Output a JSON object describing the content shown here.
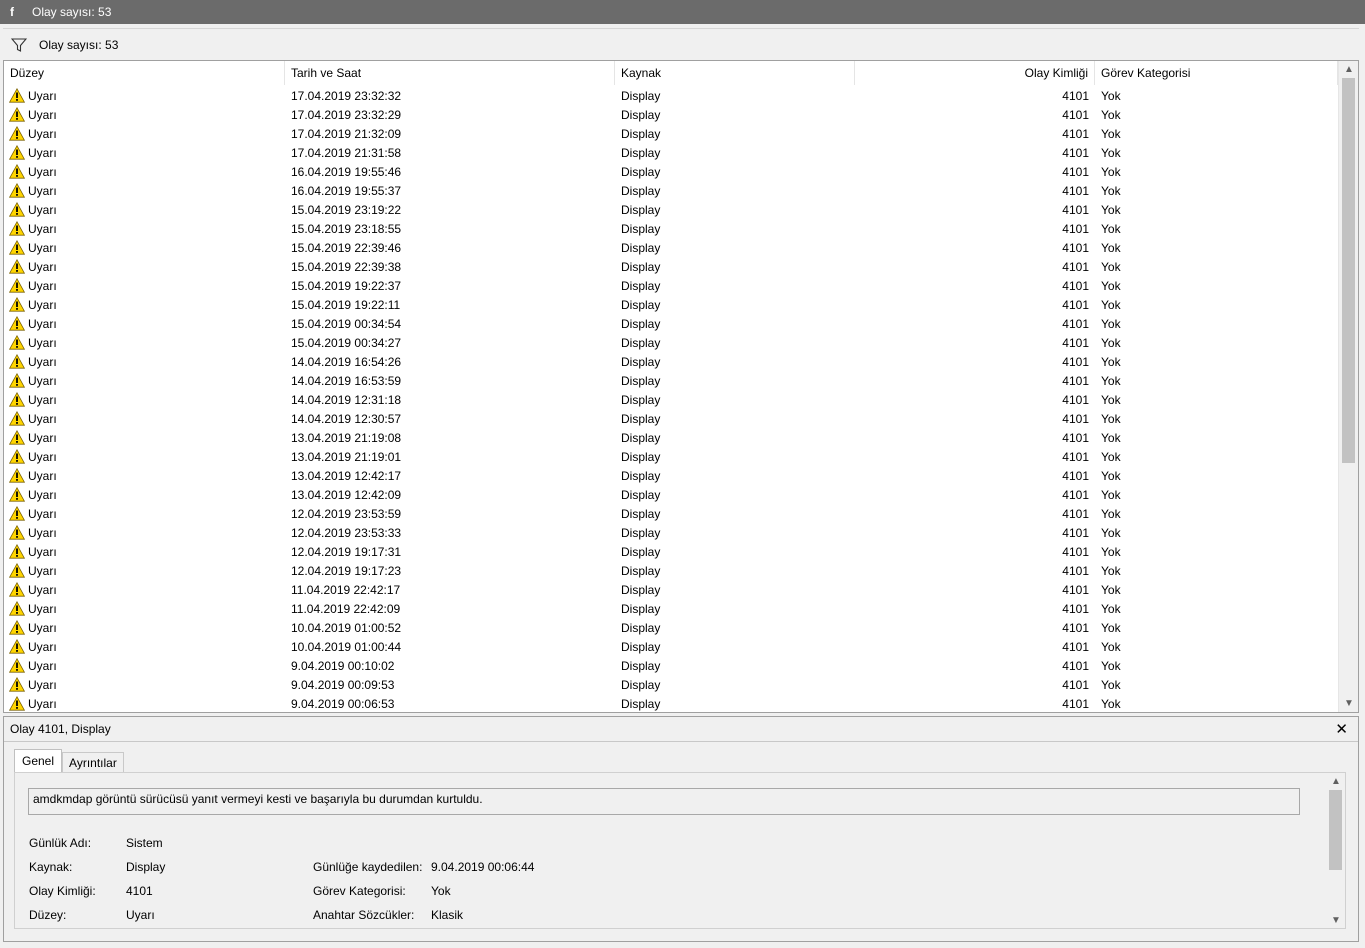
{
  "window": {
    "app_glyph": "f",
    "title": "Olay sayısı: 53"
  },
  "filter": {
    "text": "Olay sayısı: 53"
  },
  "table": {
    "columns": [
      "Düzey",
      "Tarih ve Saat",
      "Kaynak",
      "Olay Kimliği",
      "Görev Kategorisi"
    ],
    "rows": [
      [
        "Uyarı",
        "17.04.2019 23:32:32",
        "Display",
        "4101",
        "Yok"
      ],
      [
        "Uyarı",
        "17.04.2019 23:32:29",
        "Display",
        "4101",
        "Yok"
      ],
      [
        "Uyarı",
        "17.04.2019 21:32:09",
        "Display",
        "4101",
        "Yok"
      ],
      [
        "Uyarı",
        "17.04.2019 21:31:58",
        "Display",
        "4101",
        "Yok"
      ],
      [
        "Uyarı",
        "16.04.2019 19:55:46",
        "Display",
        "4101",
        "Yok"
      ],
      [
        "Uyarı",
        "16.04.2019 19:55:37",
        "Display",
        "4101",
        "Yok"
      ],
      [
        "Uyarı",
        "15.04.2019 23:19:22",
        "Display",
        "4101",
        "Yok"
      ],
      [
        "Uyarı",
        "15.04.2019 23:18:55",
        "Display",
        "4101",
        "Yok"
      ],
      [
        "Uyarı",
        "15.04.2019 22:39:46",
        "Display",
        "4101",
        "Yok"
      ],
      [
        "Uyarı",
        "15.04.2019 22:39:38",
        "Display",
        "4101",
        "Yok"
      ],
      [
        "Uyarı",
        "15.04.2019 19:22:37",
        "Display",
        "4101",
        "Yok"
      ],
      [
        "Uyarı",
        "15.04.2019 19:22:11",
        "Display",
        "4101",
        "Yok"
      ],
      [
        "Uyarı",
        "15.04.2019 00:34:54",
        "Display",
        "4101",
        "Yok"
      ],
      [
        "Uyarı",
        "15.04.2019 00:34:27",
        "Display",
        "4101",
        "Yok"
      ],
      [
        "Uyarı",
        "14.04.2019 16:54:26",
        "Display",
        "4101",
        "Yok"
      ],
      [
        "Uyarı",
        "14.04.2019 16:53:59",
        "Display",
        "4101",
        "Yok"
      ],
      [
        "Uyarı",
        "14.04.2019 12:31:18",
        "Display",
        "4101",
        "Yok"
      ],
      [
        "Uyarı",
        "14.04.2019 12:30:57",
        "Display",
        "4101",
        "Yok"
      ],
      [
        "Uyarı",
        "13.04.2019 21:19:08",
        "Display",
        "4101",
        "Yok"
      ],
      [
        "Uyarı",
        "13.04.2019 21:19:01",
        "Display",
        "4101",
        "Yok"
      ],
      [
        "Uyarı",
        "13.04.2019 12:42:17",
        "Display",
        "4101",
        "Yok"
      ],
      [
        "Uyarı",
        "13.04.2019 12:42:09",
        "Display",
        "4101",
        "Yok"
      ],
      [
        "Uyarı",
        "12.04.2019 23:53:59",
        "Display",
        "4101",
        "Yok"
      ],
      [
        "Uyarı",
        "12.04.2019 23:53:33",
        "Display",
        "4101",
        "Yok"
      ],
      [
        "Uyarı",
        "12.04.2019 19:17:31",
        "Display",
        "4101",
        "Yok"
      ],
      [
        "Uyarı",
        "12.04.2019 19:17:23",
        "Display",
        "4101",
        "Yok"
      ],
      [
        "Uyarı",
        "11.04.2019 22:42:17",
        "Display",
        "4101",
        "Yok"
      ],
      [
        "Uyarı",
        "11.04.2019 22:42:09",
        "Display",
        "4101",
        "Yok"
      ],
      [
        "Uyarı",
        "10.04.2019 01:00:52",
        "Display",
        "4101",
        "Yok"
      ],
      [
        "Uyarı",
        "10.04.2019 01:00:44",
        "Display",
        "4101",
        "Yok"
      ],
      [
        "Uyarı",
        "9.04.2019 00:10:02",
        "Display",
        "4101",
        "Yok"
      ],
      [
        "Uyarı",
        "9.04.2019 00:09:53",
        "Display",
        "4101",
        "Yok"
      ],
      [
        "Uyarı",
        "9.04.2019 00:06:53",
        "Display",
        "4101",
        "Yok"
      ]
    ]
  },
  "detail": {
    "title": "Olay 4101, Display",
    "close_glyph": "✕",
    "tabs": [
      "Genel",
      "Ayrıntılar"
    ],
    "message": "amdkmdap görüntü sürücüsü yanıt vermeyi kesti ve başarıyla bu durumdan kurtuldu.",
    "fields": {
      "log_name_label": "Günlük Adı:",
      "log_name": "Sistem",
      "source_label": "Kaynak:",
      "source": "Display",
      "event_id_label": "Olay Kimliği:",
      "event_id": "4101",
      "level_label": "Düzey:",
      "level": "Uyarı",
      "logged_label": "Günlüğe kaydedilen:",
      "logged": "9.04.2019 00:06:44",
      "task_category_label": "Görev Kategorisi:",
      "task_category": "Yok",
      "keywords_label": "Anahtar Sözcükler:",
      "keywords": "Klasik"
    }
  },
  "colors": {
    "titlebar": "#6b6b6b",
    "warning_fill": "#ffd500",
    "scroll_thumb": "#c2c2c2"
  },
  "icons": {
    "filter": "filter-icon",
    "warning": "warning-icon",
    "close": "close-icon"
  }
}
